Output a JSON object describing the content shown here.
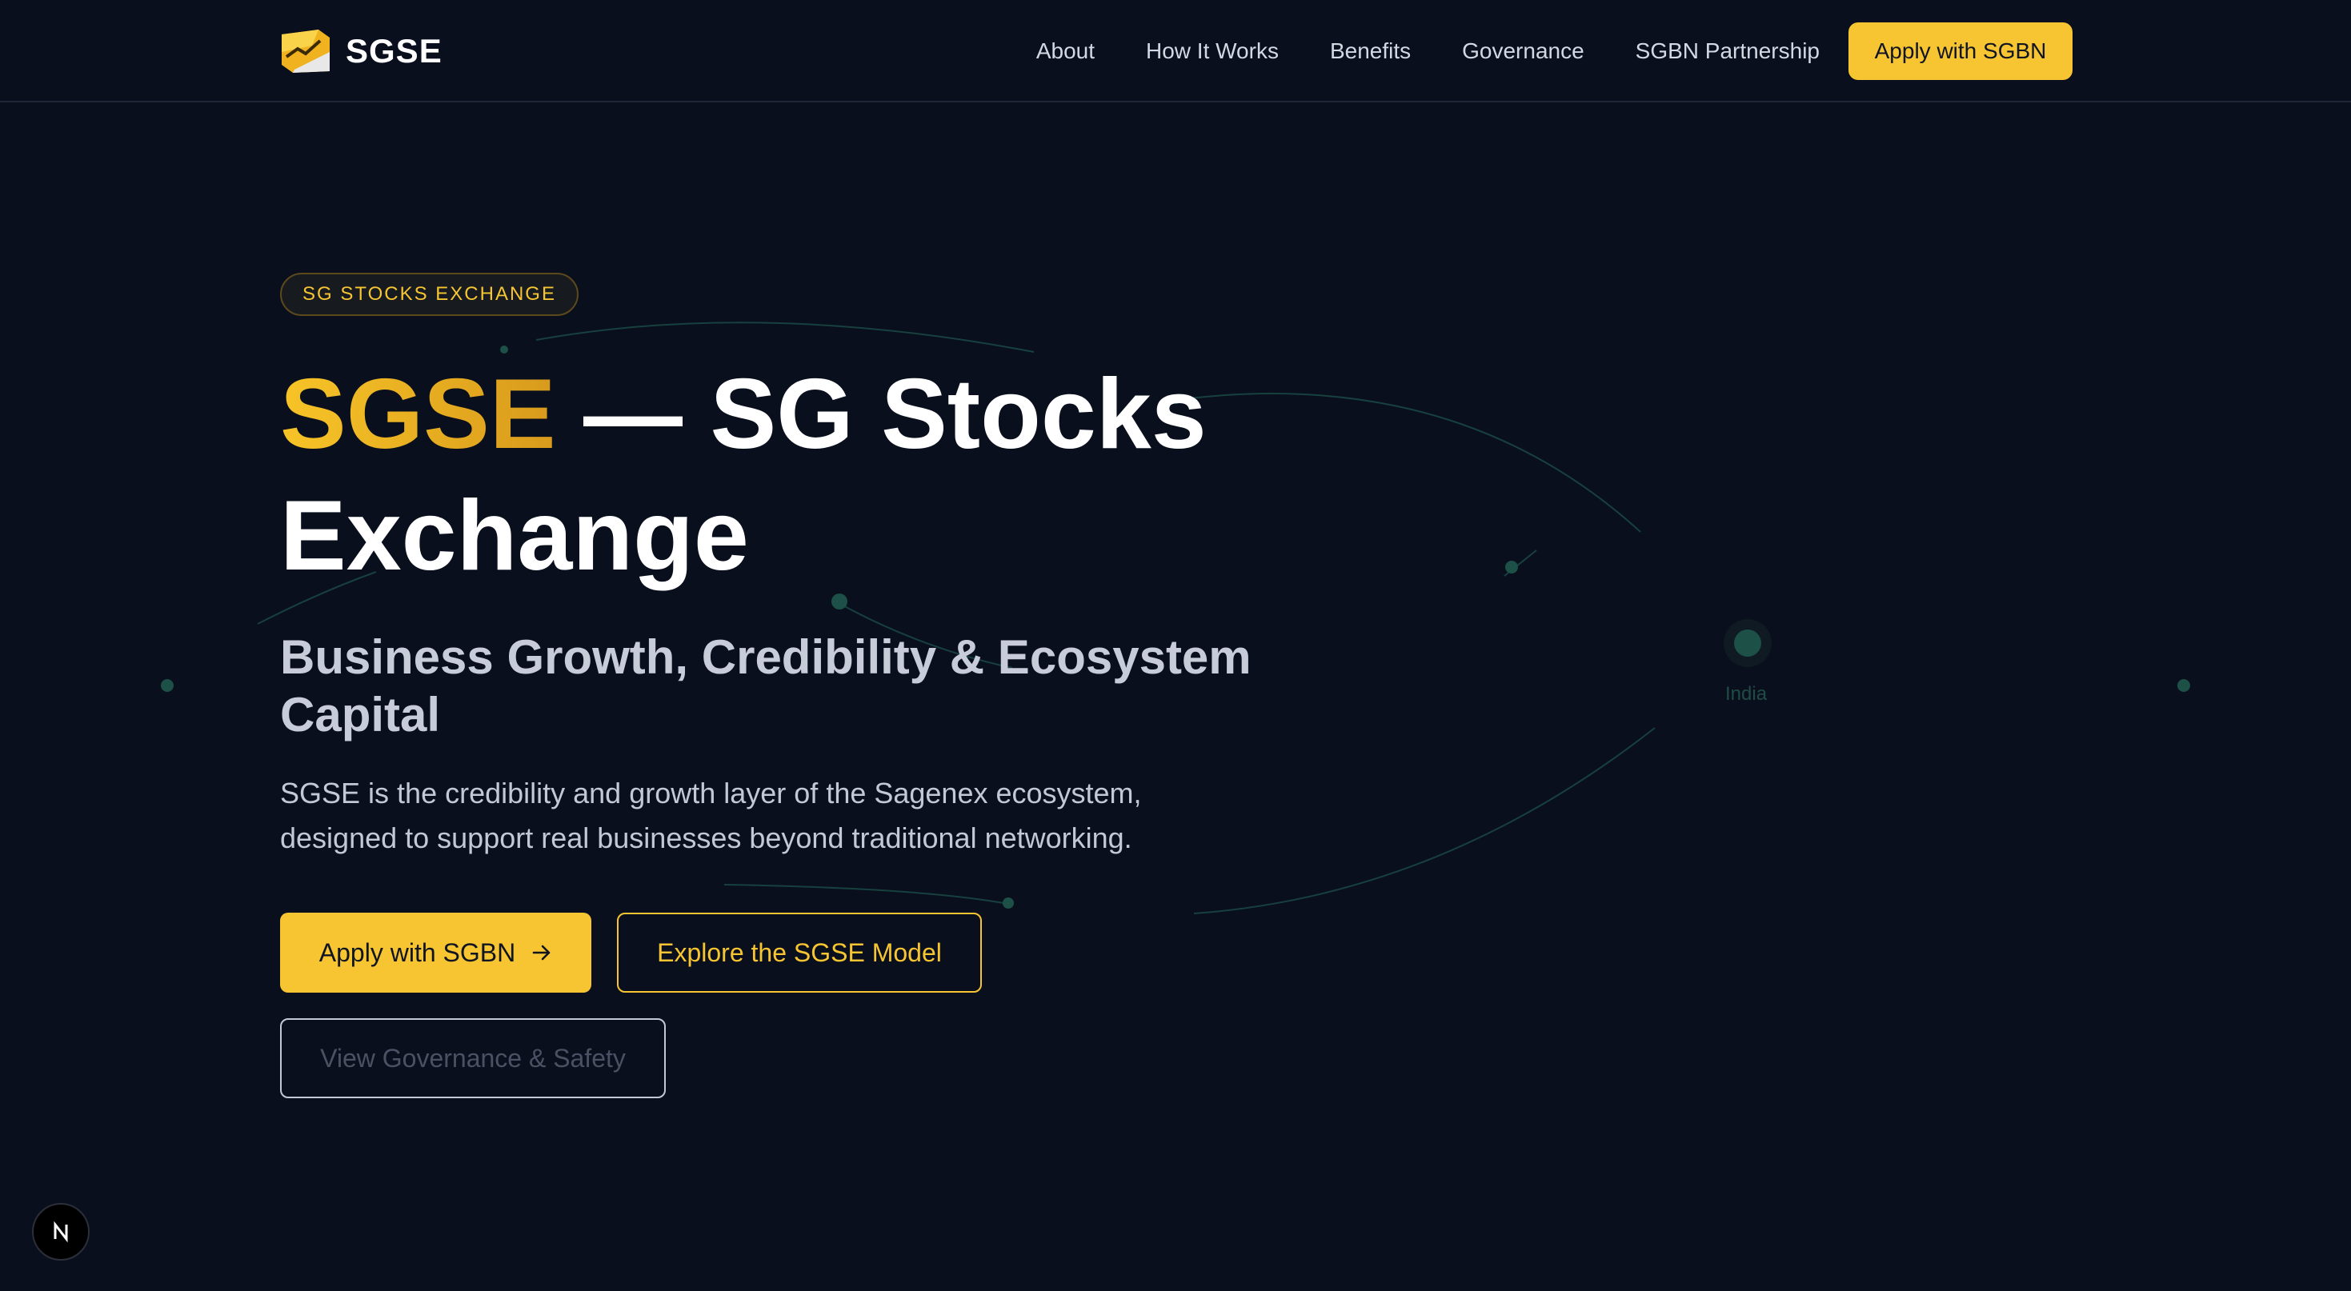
{
  "nav": {
    "brand": "SGSE",
    "links": [
      "About",
      "How It Works",
      "Benefits",
      "Governance",
      "SGBN Partnership"
    ],
    "cta": "Apply with SGBN"
  },
  "hero": {
    "badge": "SG STOCKS EXCHANGE",
    "title_accent": "SGSE",
    "title_rest": " — SG Stocks Exchange",
    "subtitle": "Business Growth, Credibility & Ecosystem Capital",
    "description": "SGSE is the credibility and growth layer of the Sagenex ecosystem, designed to support real businesses beyond traditional networking.",
    "buttons": {
      "primary": "Apply with SGBN",
      "secondary": "Explore the SGSE Model",
      "tertiary": "View Governance & Safety"
    }
  },
  "map": {
    "label": "India"
  },
  "dev_badge": {
    "icon": "next-logo-icon"
  },
  "colors": {
    "background": "#0a0f1e",
    "accent": "#f6c531",
    "map_line": "#1b4a48"
  }
}
